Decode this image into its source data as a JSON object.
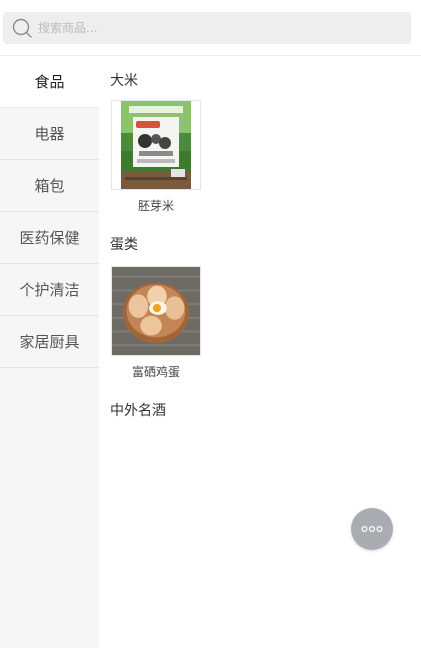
{
  "search": {
    "placeholder": "搜索商品..."
  },
  "sidebar": {
    "items": [
      {
        "label": "食品",
        "active": true
      },
      {
        "label": "电器",
        "active": false
      },
      {
        "label": "箱包",
        "active": false
      },
      {
        "label": "医药保健",
        "active": false
      },
      {
        "label": "个护清洁",
        "active": false
      },
      {
        "label": "家居厨具",
        "active": false
      }
    ]
  },
  "content": {
    "sections": [
      {
        "title": "大米",
        "products": [
          {
            "name": "胚芽米",
            "image": "rice-bag-image"
          }
        ]
      },
      {
        "title": "蛋类",
        "products": [
          {
            "name": "富硒鸡蛋",
            "image": "eggs-image"
          }
        ]
      },
      {
        "title": "中外名酒",
        "products": []
      }
    ]
  },
  "fab": {
    "icon": "more-dots-icon"
  },
  "colors": {
    "search_bg": "#eeeeee",
    "sidebar_bg": "#f6f6f6",
    "fab_bg": "#a9adb1"
  }
}
